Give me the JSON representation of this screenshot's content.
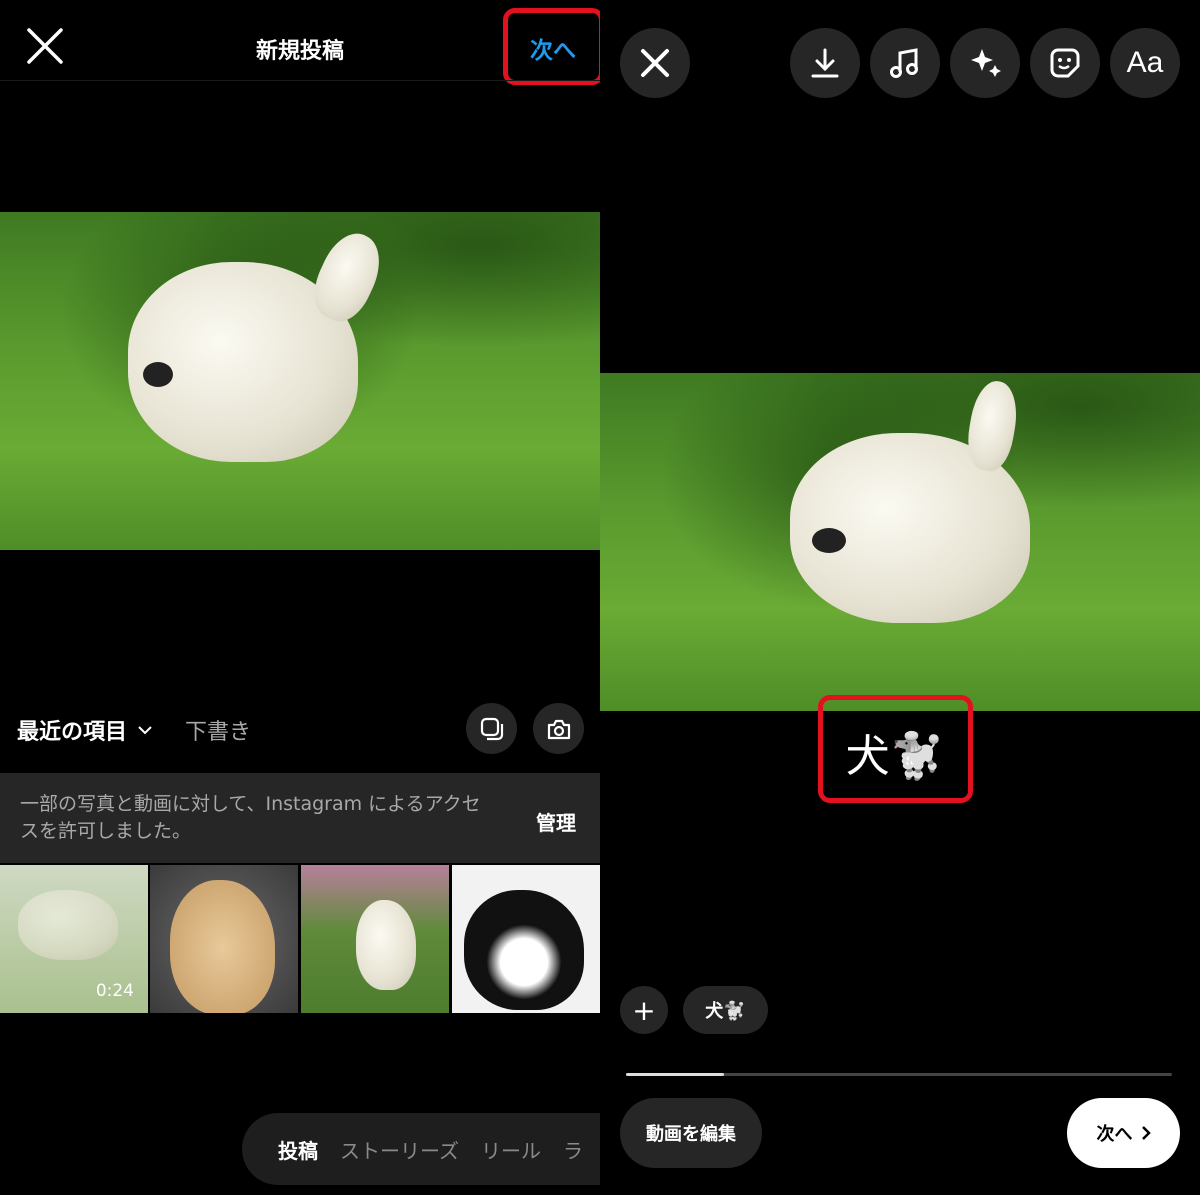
{
  "left": {
    "header": {
      "title": "新規投稿",
      "next_label": "次へ",
      "next_color": "#1d9bf0",
      "close_icon": "close-icon"
    },
    "gallery": {
      "album_label": "最近の項目",
      "drafts_label": "下書き",
      "multi_select_icon": "multi-select-icon",
      "camera_icon": "camera-icon"
    },
    "banner": {
      "message": "一部の写真と動画に対して、Instagram によるアクセスを許可しました。",
      "manage_label": "管理"
    },
    "thumbnails": [
      {
        "duration": "0:24"
      },
      {},
      {},
      {}
    ],
    "mode_tabs": [
      {
        "label": "投稿",
        "active": true
      },
      {
        "label": "ストーリーズ"
      },
      {
        "label": "リール"
      },
      {
        "label": "ラ"
      }
    ]
  },
  "right": {
    "toolbar": [
      "download-icon",
      "music-icon",
      "effects-icon",
      "sticker-icon",
      "text-icon"
    ],
    "text_tool_label": "Aa",
    "caption": "犬🐩",
    "chips": {
      "add": "+",
      "caption_chip": "犬🐩"
    },
    "progress_percent": 18,
    "edit_video_label": "動画を編集",
    "next_label": "次へ"
  },
  "highlight_color": "#e3101f"
}
